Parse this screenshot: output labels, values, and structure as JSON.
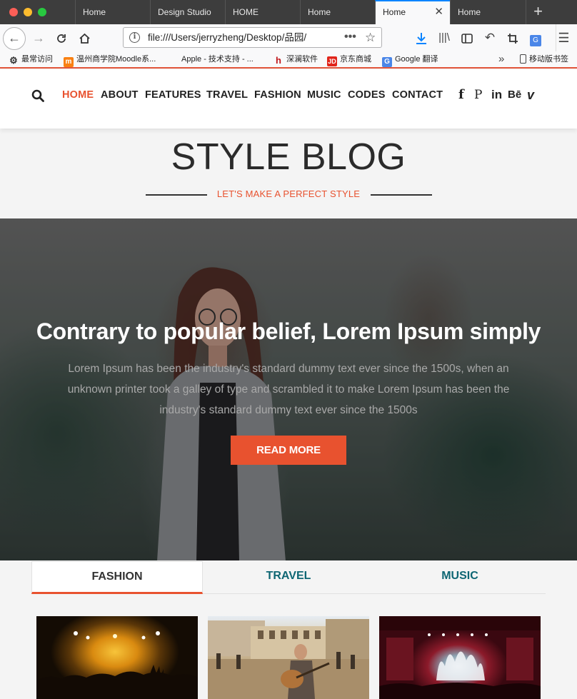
{
  "browser": {
    "tabs": [
      {
        "label": "Home",
        "active": false
      },
      {
        "label": "Design Studio",
        "active": false
      },
      {
        "label": "HOME",
        "active": false
      },
      {
        "label": "Home",
        "active": false
      },
      {
        "label": "Home",
        "active": true
      },
      {
        "label": "Home",
        "active": false
      }
    ],
    "url": "file:///Users/jerryzheng/Desktop/品园/",
    "bookmarks": [
      {
        "label": "最常访问",
        "icon": "gear-icon"
      },
      {
        "label": "温州商学院Moodle系...",
        "icon": "moodle-icon"
      },
      {
        "label": "Apple - 技术支持 - ...",
        "icon": "apple-icon"
      },
      {
        "label": "深澜软件",
        "icon": "srun-icon"
      },
      {
        "label": "京东商城",
        "icon": "jd-icon"
      },
      {
        "label": "Google 翻译",
        "icon": "google-translate-icon"
      },
      {
        "label": "移动版书签",
        "icon": "mobile-bookmarks-icon"
      }
    ]
  },
  "site": {
    "menu": [
      "HOME",
      "ABOUT",
      "FEATURES",
      "TRAVEL",
      "FASHION",
      "MUSIC",
      "CODES",
      "CONTACT"
    ],
    "active_menu": "HOME",
    "social": [
      {
        "label": "f",
        "icon": "facebook-icon"
      },
      {
        "label": "P",
        "icon": "pinterest-icon"
      },
      {
        "label": "in",
        "icon": "linkedin-icon"
      },
      {
        "label": "Bē",
        "icon": "behance-icon"
      },
      {
        "label": "v",
        "icon": "vimeo-icon"
      }
    ],
    "blog_title": "STYLE BLOG",
    "tagline": "LET'S MAKE A PERFECT STYLE"
  },
  "hero": {
    "title": "Contrary to popular belief, Lorem Ipsum simply",
    "text": "Lorem Ipsum has been the industry's standard dummy text ever since the 1500s, when an unknown printer took a galley of type and scrambled it to make Lorem Ipsum has been the industry's standard dummy text ever since the 1500s",
    "button": "READ MORE"
  },
  "categories": [
    "FASHION",
    "TRAVEL",
    "MUSIC"
  ],
  "active_category": "FASHION",
  "colors": {
    "accent": "#e8522f",
    "teal": "#0e6673",
    "tab_indicator": "#0a84ff"
  }
}
